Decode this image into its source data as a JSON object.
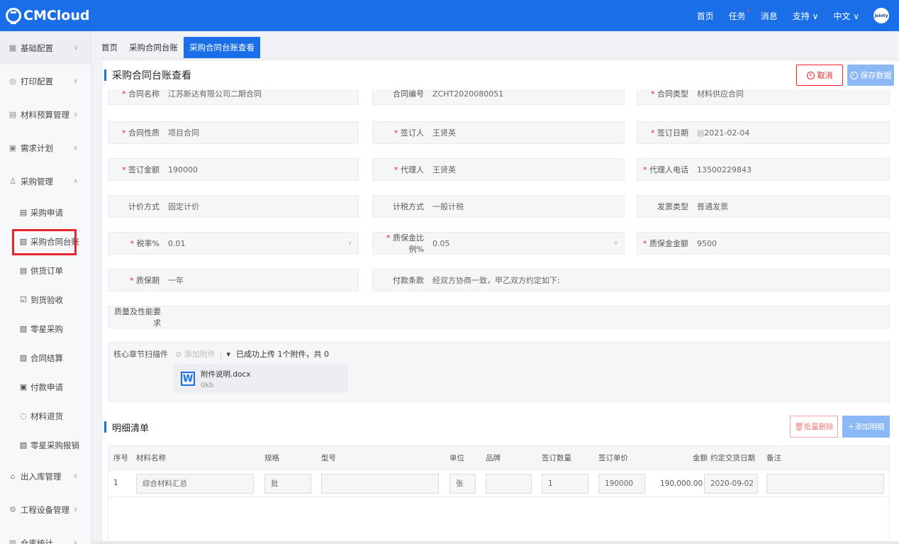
{
  "header": {
    "logo_text": "CMCloud",
    "nav": [
      {
        "label": "首页"
      },
      {
        "label": "任务"
      },
      {
        "label": "消息"
      },
      {
        "label": "支持 ∨"
      },
      {
        "label": "中文 ∨"
      }
    ],
    "task_dot": "•",
    "avatar_text": "jointy"
  },
  "sidebar": {
    "groups": [
      {
        "label": "基础配置",
        "icon": "grid-icon"
      },
      {
        "label": "打印配置",
        "icon": "print-icon"
      },
      {
        "label": "材料预算管理",
        "icon": "budget-icon"
      },
      {
        "label": "需求计划",
        "icon": "plan-icon"
      },
      {
        "label": "采购管理",
        "icon": "purchase-icon"
      }
    ],
    "subitems": [
      {
        "label": "采购申请",
        "icon": "doc-icon"
      },
      {
        "label": "采购合同台账",
        "icon": "contract-icon"
      },
      {
        "label": "供货订单",
        "icon": "doc-icon"
      },
      {
        "label": "到货验收",
        "icon": "check-icon"
      },
      {
        "label": "零星采购",
        "icon": "doc-icon"
      },
      {
        "label": "合同结算",
        "icon": "doc-icon"
      },
      {
        "label": "付款申请",
        "icon": "payment-icon"
      },
      {
        "label": "材料退货",
        "icon": "return-icon"
      },
      {
        "label": "零星采购报销",
        "icon": "doc-icon"
      }
    ],
    "groups_bottom": [
      {
        "label": "出入库管理",
        "icon": "warehouse-icon"
      },
      {
        "label": "工程设备管理",
        "icon": "equipment-icon"
      },
      {
        "label": "仓库统计",
        "icon": "stats-icon"
      }
    ]
  },
  "tabs": [
    {
      "label": "首页"
    },
    {
      "label": "采购合同台账"
    },
    {
      "label": "采购合同台账查看"
    }
  ],
  "panel": {
    "title": "采购合同台账查看",
    "cancel_label": "取消",
    "save_label": "保存数据"
  },
  "form": {
    "contract_name": {
      "label": "合同名称",
      "value": "江苏新达有限公司二期合同"
    },
    "contract_no": {
      "label": "合同编号",
      "value": "ZCHT2020080051"
    },
    "contract_type": {
      "label": "合同类型",
      "value": "材料供应合同"
    },
    "contract_nature": {
      "label": "合同性质",
      "value": "项目合同"
    },
    "signer": {
      "label": "签订人",
      "value": "王贤英"
    },
    "sign_date": {
      "label": "签订日期",
      "value": "2021-02-04"
    },
    "sign_amount": {
      "label": "签订金额",
      "value": "190000"
    },
    "agent": {
      "label": "代理人",
      "value": "王贤英"
    },
    "agent_phone": {
      "label": "代理人电话",
      "value": "13500229843"
    },
    "pricing": {
      "label": "计价方式",
      "value": "固定计价"
    },
    "tax_method": {
      "label": "计税方式",
      "value": "一般计税"
    },
    "invoice_type": {
      "label": "发票类型",
      "value": "普通发票"
    },
    "tax_rate": {
      "label": "税率%",
      "value": "0.01"
    },
    "retention_ratio": {
      "label": "质保金比例%",
      "value": "0.05"
    },
    "retention_amount": {
      "label": "质保金金额",
      "value": "9500"
    },
    "warranty": {
      "label": "质保期",
      "value": "一年"
    },
    "payment_terms": {
      "label": "付款条款",
      "value": "经双方协商一致，甲乙双方约定如下:"
    },
    "quality": {
      "label": "质量及性能要求",
      "value": ""
    },
    "upload": {
      "label": "核心章节扫描件",
      "add_label": "添加附件",
      "status": "已成功上传 1个附件，共 0",
      "file_name": "附件说明.docx",
      "file_size": "0kb"
    }
  },
  "detail": {
    "title": "明细清单",
    "batch_delete_label": "批量删除",
    "add_detail_label": "添加明细",
    "columns": [
      "序号",
      "材料名称",
      "规格",
      "型号",
      "单位",
      "品牌",
      "签订数量",
      "签订单价",
      "金额",
      "约定交货日期",
      "备注"
    ],
    "rows": [
      {
        "index": "1",
        "name": "综合材料汇总",
        "spec": "批",
        "model": "",
        "unit": "张",
        "brand": "",
        "qty": "1",
        "price": "190000",
        "amount": "190,000.00",
        "date": "2020-09-02",
        "note": ""
      }
    ]
  }
}
